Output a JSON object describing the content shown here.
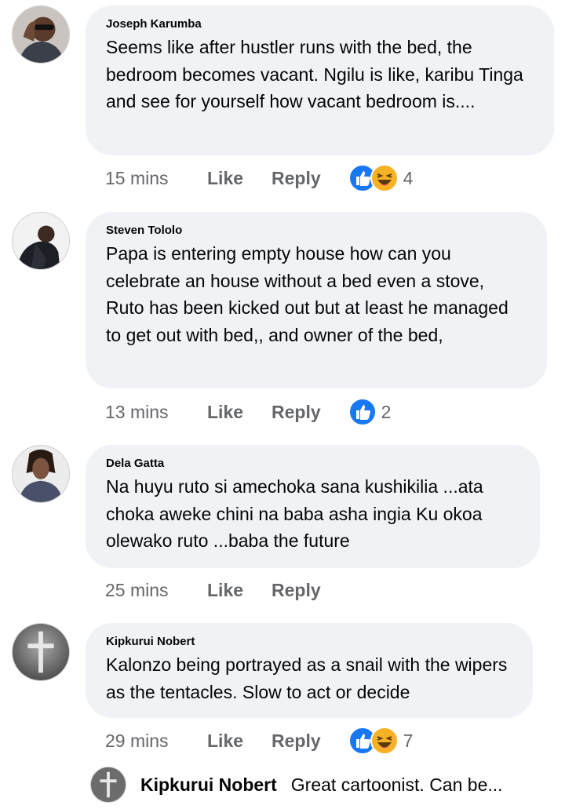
{
  "comments": [
    {
      "author": "Joseph Karumba",
      "text": "Seems like after hustler runs with the bed, the bedroom becomes vacant. Ngilu is like, karibu Tinga and see for yourself how vacant bedroom is....",
      "time": "15 mins",
      "like_label": "Like",
      "reply_label": "Reply",
      "reactions": [
        "like-icon",
        "haha-icon"
      ],
      "reaction_count": "4"
    },
    {
      "author": "Steven Tololo",
      "text": "Papa is entering empty house how can you celebrate an house without a bed even a stove, Ruto has been kicked out but at least he managed to get out with bed,, and owner of the bed,",
      "time": "13 mins",
      "like_label": "Like",
      "reply_label": "Reply",
      "reactions": [
        "like-icon"
      ],
      "reaction_count": "2"
    },
    {
      "author": "Dela Gatta",
      "text": "Na huyu ruto si amechoka sana kushikilia ...ata choka aweke chini na baba asha ingia Ku okoa olewako ruto ...baba the future",
      "time": "25 mins",
      "like_label": "Like",
      "reply_label": "Reply"
    },
    {
      "author": "Kipkurui Nobert",
      "text": "Kalonzo being portrayed as a snail with the wipers as the tentacles. Slow to act or decide",
      "time": "29 mins",
      "like_label": "Like",
      "reply_label": "Reply",
      "reactions": [
        "like-icon",
        "haha-icon"
      ],
      "reaction_count": "7"
    }
  ],
  "reply_preview": {
    "author": "Kipkurui Nobert",
    "text": "Great cartoonist. Can be..."
  },
  "colors": {
    "bubble": "#f0f2f5",
    "meta_text": "#65676b",
    "like_blue": "#1877f2",
    "haha_yellow": "#f7b125"
  }
}
